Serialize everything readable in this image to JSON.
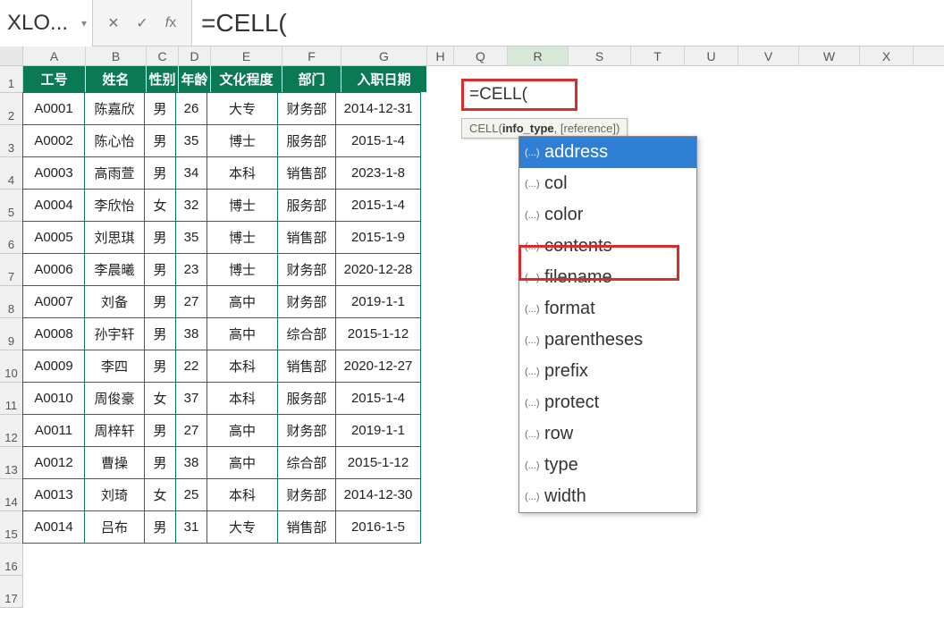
{
  "formula_bar": {
    "name_box": "XLO...",
    "formula": "=CELL("
  },
  "columns": [
    "A",
    "B",
    "C",
    "D",
    "E",
    "F",
    "G",
    "H",
    "Q",
    "R",
    "S",
    "T",
    "U",
    "V",
    "W",
    "X"
  ],
  "selected_column": "R",
  "table": {
    "headers": [
      "工号",
      "姓名",
      "性别",
      "年龄",
      "文化程度",
      "部门",
      "入职日期"
    ],
    "rows": [
      [
        "A0001",
        "陈嘉欣",
        "男",
        "26",
        "大专",
        "财务部",
        "2014-12-31"
      ],
      [
        "A0002",
        "陈心怡",
        "男",
        "35",
        "博士",
        "服务部",
        "2015-1-4"
      ],
      [
        "A0003",
        "高雨萱",
        "男",
        "34",
        "本科",
        "销售部",
        "2023-1-8"
      ],
      [
        "A0004",
        "李欣怡",
        "女",
        "32",
        "博士",
        "服务部",
        "2015-1-4"
      ],
      [
        "A0005",
        "刘思琪",
        "男",
        "35",
        "博士",
        "销售部",
        "2015-1-9"
      ],
      [
        "A0006",
        "李晨曦",
        "男",
        "23",
        "博士",
        "财务部",
        "2020-12-28"
      ],
      [
        "A0007",
        "刘备",
        "男",
        "27",
        "高中",
        "财务部",
        "2019-1-1"
      ],
      [
        "A0008",
        "孙宇轩",
        "男",
        "38",
        "高中",
        "综合部",
        "2015-1-12"
      ],
      [
        "A0009",
        "李四",
        "男",
        "22",
        "本科",
        "销售部",
        "2020-12-27"
      ],
      [
        "A0010",
        "周俊豪",
        "女",
        "37",
        "本科",
        "服务部",
        "2015-1-4"
      ],
      [
        "A0011",
        "周梓轩",
        "男",
        "27",
        "高中",
        "财务部",
        "2019-1-1"
      ],
      [
        "A0012",
        "曹操",
        "男",
        "38",
        "高中",
        "综合部",
        "2015-1-12"
      ],
      [
        "A0013",
        "刘琦",
        "女",
        "25",
        "本科",
        "财务部",
        "2014-12-30"
      ],
      [
        "A0014",
        "吕布",
        "男",
        "31",
        "大专",
        "销售部",
        "2016-1-5"
      ]
    ]
  },
  "editing_cell_value": "=CELL(",
  "arg_tooltip": {
    "fn": "CELL(",
    "bold": "info_type",
    "rest": ", [reference])"
  },
  "autocomplete": {
    "selected_index": 0,
    "highlighted_index": 3,
    "items": [
      "address",
      "col",
      "color",
      "contents",
      "filename",
      "format",
      "parentheses",
      "prefix",
      "protect",
      "row",
      "type",
      "width"
    ]
  },
  "row_numbers": [
    1,
    2,
    3,
    4,
    5,
    6,
    7,
    8,
    9,
    10,
    11,
    12,
    13,
    14,
    15,
    16,
    17
  ]
}
